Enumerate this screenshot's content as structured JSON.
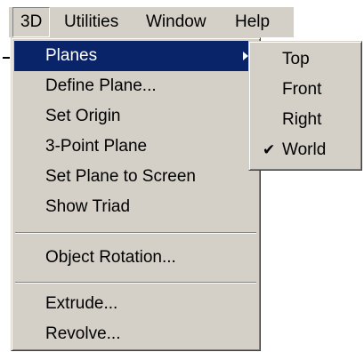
{
  "menubar": {
    "items": [
      {
        "label": "3D"
      },
      {
        "label": "Utilities"
      },
      {
        "label": "Window"
      },
      {
        "label": "Help"
      }
    ]
  },
  "menu_3d": {
    "items": [
      {
        "label": "Planes"
      },
      {
        "label": "Define Plane..."
      },
      {
        "label": "Set Origin"
      },
      {
        "label": "3-Point Plane"
      },
      {
        "label": "Set Plane to Screen"
      },
      {
        "label": "Show Triad"
      },
      {
        "label": "Object Rotation..."
      },
      {
        "label": "Extrude..."
      },
      {
        "label": "Revolve..."
      }
    ]
  },
  "planes_submenu": {
    "items": [
      {
        "label": "Top"
      },
      {
        "label": "Front"
      },
      {
        "label": "Right"
      },
      {
        "label": "World",
        "checked": true
      }
    ],
    "check_glyph": "✔"
  },
  "colors": {
    "menu_bg": "#d4d0c8",
    "highlight_bg": "#0a246a",
    "highlight_text": "#ffffff"
  }
}
